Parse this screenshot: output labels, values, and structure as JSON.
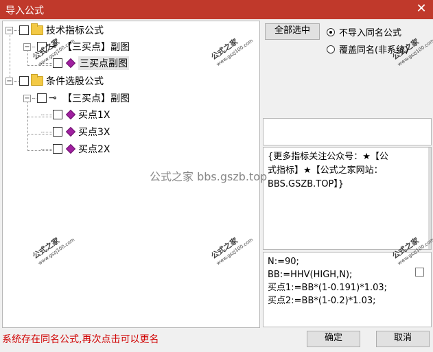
{
  "window": {
    "title": "导入公式",
    "close_glyph": "✕"
  },
  "tree": {
    "nodes": [
      {
        "label": "技术指标公式"
      },
      {
        "label": "【三买点】副图"
      },
      {
        "label": "三买点副图"
      },
      {
        "label": "条件选股公式"
      },
      {
        "label": "【三买点】副图"
      },
      {
        "label": "买点1X"
      },
      {
        "label": "买点3X"
      },
      {
        "label": "买点2X"
      }
    ]
  },
  "actions": {
    "select_all": "全部选中",
    "ok": "确定",
    "cancel": "取消"
  },
  "options": {
    "no_import_same_name": "不导入同名公式",
    "overwrite_same_name": "覆盖同名(非系统)"
  },
  "description": {
    "lines": [
      "{更多指标关注公众号：★【公",
      "式指标】★【公式之家网站：",
      "BBS.GSZB.TOP】}"
    ]
  },
  "code": {
    "lines": [
      "N:=90;",
      "BB:=HHV(HIGH,N);",
      "买点1:=BB*(1-0.191)*1.03;",
      "买点2:=BB*(1-0.2)*1.03;"
    ]
  },
  "status": {
    "message": "系统存在同名公式,再次点击可以更名"
  },
  "watermark": {
    "main": "公式之家",
    "sub": "www.gszj100.com",
    "center": "公式之家 bbs.gszb.top"
  },
  "colors": {
    "titlebar": "#c0392b",
    "status_text": "#d00000",
    "diamond": "#a020a0",
    "folder": "#f3c945"
  }
}
